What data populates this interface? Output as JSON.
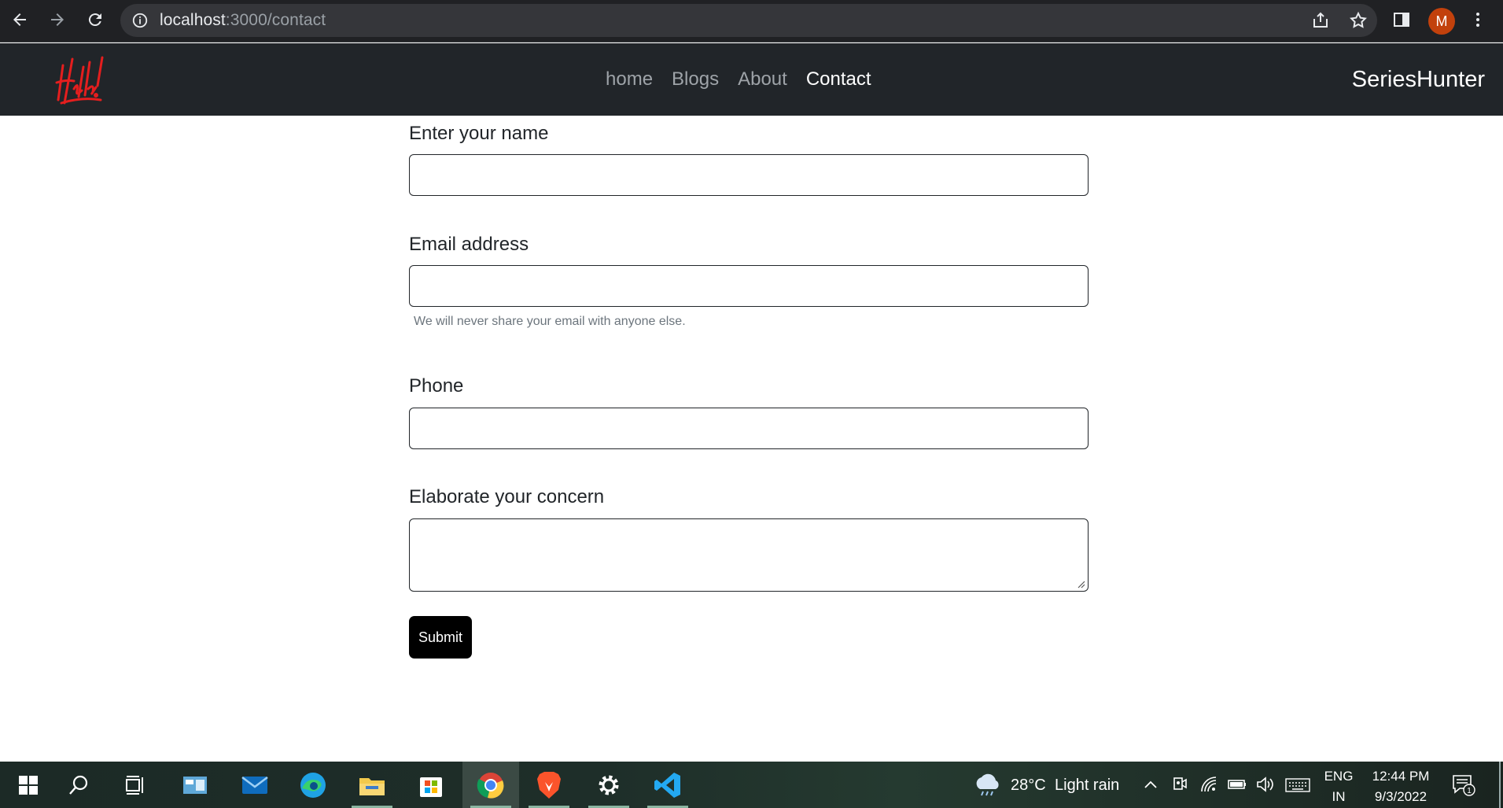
{
  "browser": {
    "url_host": "localhost",
    "url_path": ":3000/contact",
    "profile_initial": "M"
  },
  "navbar": {
    "logo_text": "Hello!",
    "links": [
      {
        "label": "home"
      },
      {
        "label": "Blogs"
      },
      {
        "label": "About"
      },
      {
        "label": "Contact",
        "active": true
      }
    ],
    "brand": "SeriesHunter"
  },
  "form": {
    "name_label": "Enter your name",
    "name_value": "",
    "email_label": "Email address",
    "email_value": "",
    "email_help": "We will never share your email with anyone else.",
    "phone_label": "Phone",
    "phone_value": "",
    "concern_label": "Elaborate your concern",
    "concern_value": "",
    "submit_label": "Submit"
  },
  "taskbar": {
    "apps": [
      "start-icon",
      "search-icon",
      "task-view-icon",
      "widgets-icon",
      "mail-icon",
      "edge-icon",
      "file-explorer-icon",
      "store-icon",
      "chrome-icon",
      "brave-icon",
      "settings-icon",
      "vscode-icon"
    ],
    "weather_temp": "28°C",
    "weather_desc": "Light rain",
    "lang_top": "ENG",
    "lang_bottom": "IN",
    "time": "12:44 PM",
    "date": "9/3/2022",
    "notification_count": "1"
  },
  "colors": {
    "navbar_bg": "#212529",
    "browser_bg": "#202124",
    "submit_bg": "#000000",
    "logo_red": "#e41e1e"
  }
}
